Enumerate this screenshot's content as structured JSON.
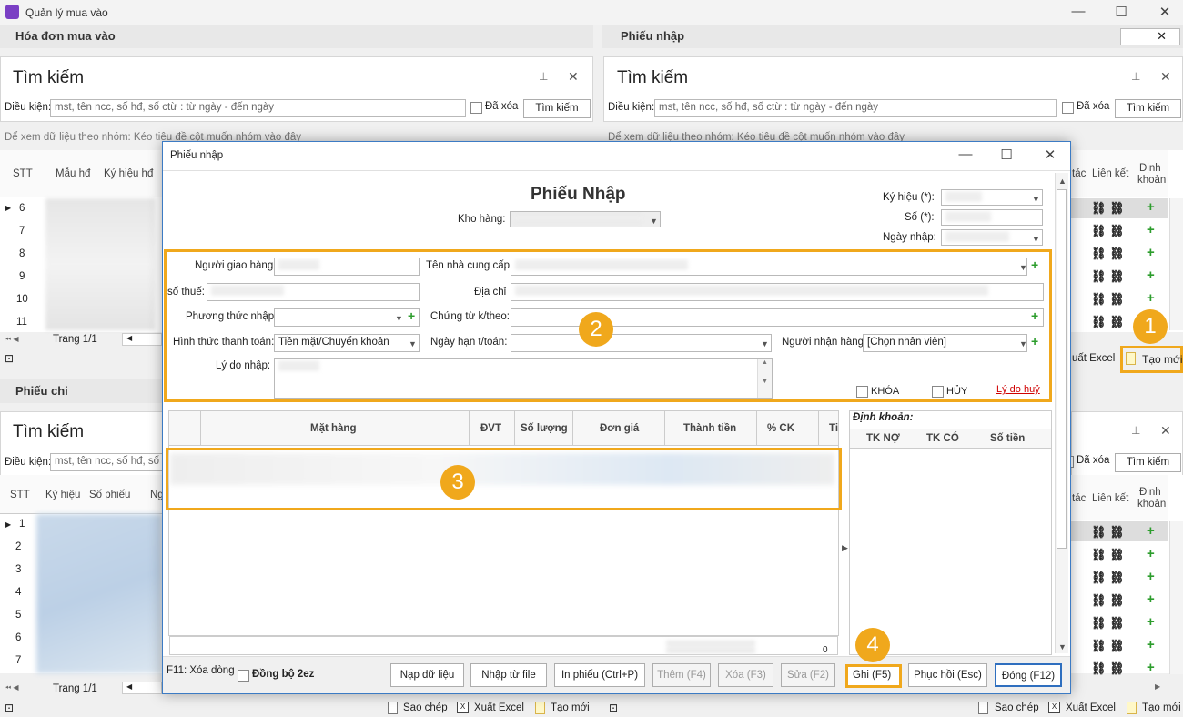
{
  "app": {
    "title": "Quản lý mua vào"
  },
  "left_top": {
    "panel_title": "Hóa đơn mua vào",
    "search_title": "Tìm kiếm",
    "condition_label": "Điều kiện:",
    "condition_placeholder": "mst, tên ncc, số hđ, số ctừ : từ ngày - đến ngày",
    "deleted_label": "Đã xóa",
    "search_button": "Tìm kiếm",
    "group_hint": "Để xem dữ liệu theo nhóm: Kéo tiêu đề cột muốn nhóm vào đây",
    "columns": [
      "STT",
      "Mẫu hđ",
      "Ký hiệu hđ"
    ],
    "rows": [
      "6",
      "7",
      "8",
      "9",
      "10",
      "11"
    ],
    "page_label": "Trang 1/1"
  },
  "right_top": {
    "panel_title": "Phiếu nhập",
    "search_title": "Tìm kiếm",
    "condition_label": "Điều kiện:",
    "condition_placeholder": "mst, tên ncc, số hđ, số ctừ : từ ngày - đến ngày",
    "deleted_label": "Đã xóa",
    "search_button": "Tìm kiếm",
    "group_hint": "Để xem dữ liệu theo nhóm: Kéo tiêu đề cột muốn nhóm vào đây",
    "col_action": "tác",
    "col_link": "Liên kết",
    "col_account_1": "Định",
    "col_account_2": "khoản",
    "export_label": "uất Excel",
    "new_label": "Tạo mới"
  },
  "left_bottom": {
    "panel_title": "Phiếu chi",
    "search_title": "Tìm kiếm",
    "condition_label": "Điều kiện:",
    "condition_placeholder": "mst, tên ncc, số hđ, số ctừ : từ ngày - đến ngày",
    "columns": [
      "STT",
      "Ký hiệu",
      "Số phiếu",
      "Ng"
    ],
    "rows": [
      "1",
      "2",
      "3",
      "4",
      "5",
      "6",
      "7"
    ],
    "page_label": "Trang 1/1",
    "copy_label": "Sao chép",
    "export_label": "Xuất Excel",
    "new_label": "Tạo mới"
  },
  "right_bottom": {
    "deleted_label": "Đã xóa",
    "search_button": "Tìm kiếm",
    "col_action": "tác",
    "col_link": "Liên kết",
    "col_account_1": "Định",
    "col_account_2": "khoản",
    "copy_label": "Sao chép",
    "export_label": "Xuất Excel",
    "new_label": "Tạo mới"
  },
  "dialog": {
    "window_title": "Phiếu nhập",
    "heading": "Phiếu Nhập",
    "warehouse_label": "Kho hàng:",
    "symbol_label": "Ký hiệu (*):",
    "number_label": "Số (*):",
    "date_label": "Ngày nhập:",
    "deliverer_label": "Người giao hàng:",
    "supplier_label": "Tên nhà cung cấp:",
    "tax_label": "số thuế:",
    "address_label": "Địa chỉ",
    "method_label": "Phương thức nhập:",
    "voucher_label": "Chứng từ k/theo:",
    "payment_label": "Hình thức thanh toán:",
    "payment_value": "Tiền mặt/Chuyển khoản",
    "due_label": "Ngày hạn t/toán:",
    "receiver_label": "Người nhận hàng:",
    "receiver_value": "[Chọn nhân viên]",
    "reason_label": "Lý do nhập:",
    "lock_label": "KHÓA",
    "cancel_label": "HỦY",
    "cancel_reason_link": "Lý do huỷ",
    "items_columns": [
      "Mặt hàng",
      "ĐVT",
      "Số lượng",
      "Đơn giá",
      "Thành tiền",
      "% CK",
      "Ti"
    ],
    "accounting_title": "Định khoản:",
    "accounting_columns": [
      "TK NỢ",
      "TK CÓ",
      "Số tiền"
    ],
    "total_value": "0",
    "hint_f11": "F11: Xóa dòng",
    "sync_label": "Đồng bộ 2ez",
    "btn_load": "Nạp dữ liệu",
    "btn_import": "Nhập từ file",
    "btn_print": "In phiếu  (Ctrl+P)",
    "btn_add": "Thêm  (F4)",
    "btn_delete": "Xóa  (F3)",
    "btn_edit": "Sửa  (F2)",
    "btn_save": "Ghi  (F5)",
    "btn_restore": "Phục hồi  (Esc)",
    "btn_close": "Đóng  (F12)"
  },
  "callouts": [
    "1",
    "2",
    "3",
    "4"
  ],
  "colors": {
    "accent_orange": "#f0a81c",
    "dialog_border": "#3c7bc4",
    "add_green": "#2d9d2d",
    "link_red": "#d00000"
  }
}
